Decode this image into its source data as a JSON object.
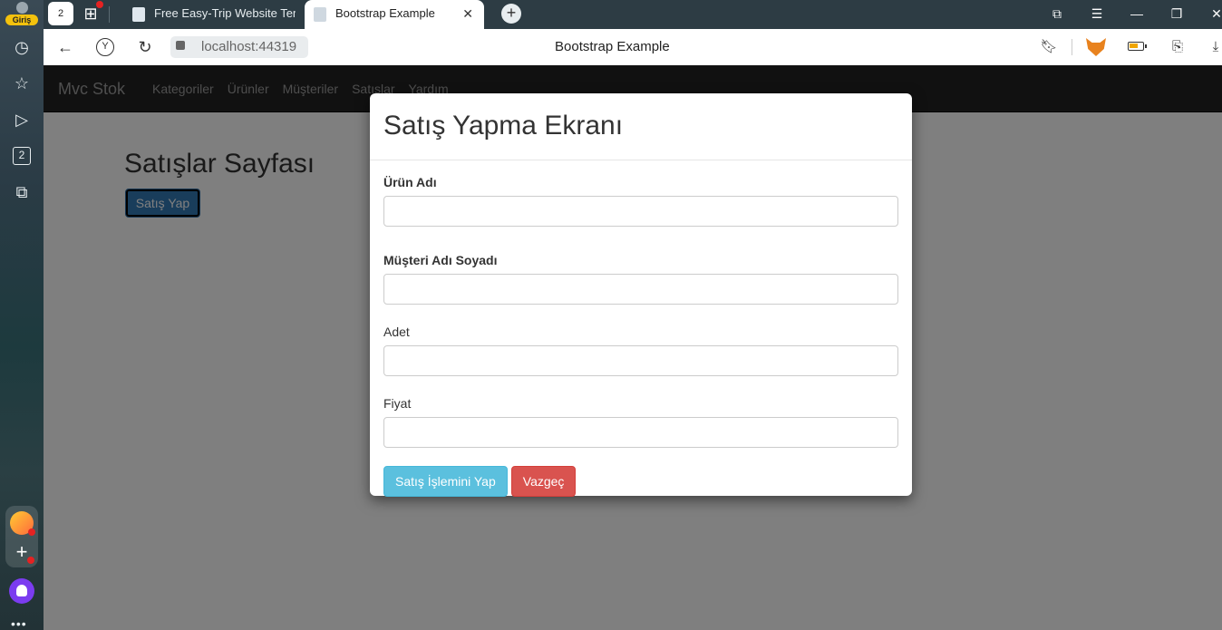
{
  "sidebar": {
    "profile_label": "Giriş",
    "tabs_count": "2"
  },
  "tabstrip": {
    "home_count": "2",
    "tabs": [
      {
        "title": "Free Easy-Trip Website Tem"
      },
      {
        "title": "Bootstrap Example"
      }
    ]
  },
  "addressbar": {
    "url": "localhost:44319",
    "page_title": "Bootstrap Example"
  },
  "page": {
    "brand": "Mvc Stok",
    "nav": [
      "Kategoriler",
      "Ürünler",
      "Müşteriler",
      "Satışlar",
      "Yardım"
    ],
    "heading": "Satışlar Sayfası",
    "open_button": "Satış Yap"
  },
  "modal": {
    "title": "Satış Yapma Ekranı",
    "fields": [
      {
        "label": "Ürün Adı",
        "value": ""
      },
      {
        "label": "Müşteri Adı Soyadı",
        "value": ""
      },
      {
        "label": "Adet",
        "value": ""
      },
      {
        "label": "Fiyat",
        "value": ""
      }
    ],
    "submit_label": "Satış İşlemini Yap",
    "cancel_label": "Vazgeç"
  },
  "colors": {
    "navbar_bg": "#222222",
    "primary": "#337ab7",
    "info": "#5bc0de",
    "danger": "#d9534f"
  }
}
